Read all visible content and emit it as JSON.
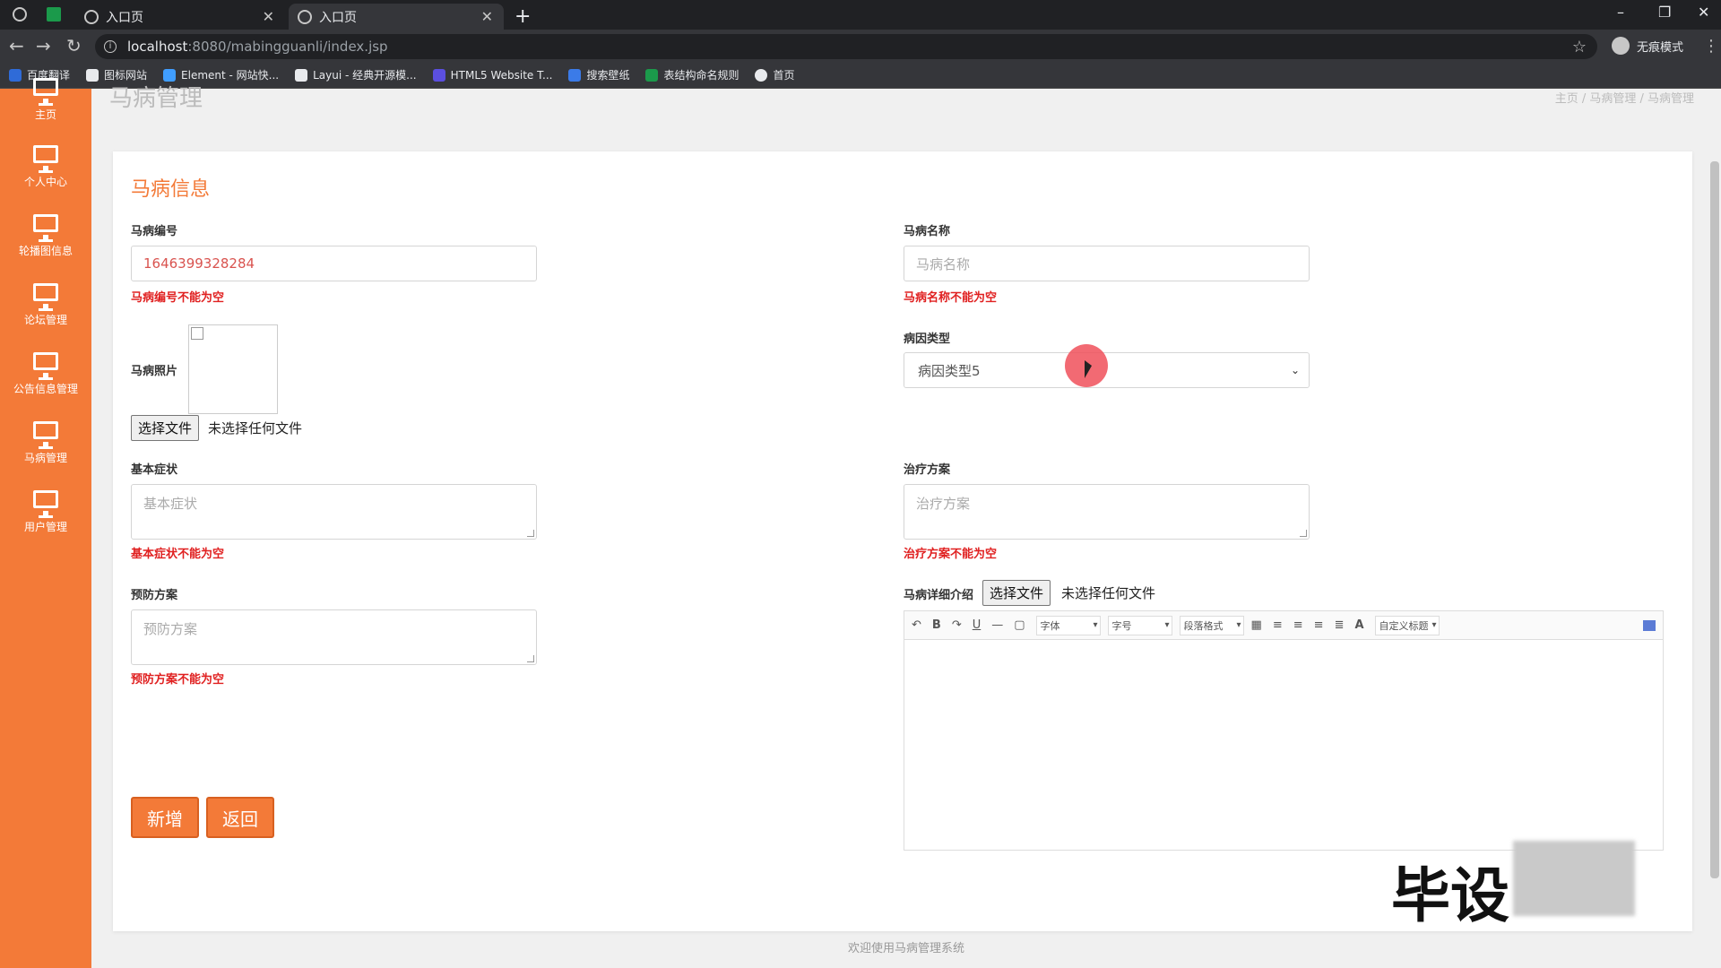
{
  "browser": {
    "tabs": [
      {
        "title": "入口页"
      },
      {
        "title": "入口页"
      }
    ],
    "url_host": "localhost",
    "url_path": ":8080/mabingguanli/index.jsp",
    "incognito_label": "无痕模式",
    "bookmarks": [
      {
        "label": "百度翻译",
        "color": "#2f6bd8"
      },
      {
        "label": "图标网站",
        "color": "#e8eaed"
      },
      {
        "label": "Element - 网站快...",
        "color": "#409eff"
      },
      {
        "label": "Layui - 经典开源模...",
        "color": "#e8eaed"
      },
      {
        "label": "HTML5 Website T...",
        "color": "#5b4fe0"
      },
      {
        "label": "搜索壁纸",
        "color": "#3b7be8"
      },
      {
        "label": "表结构命名规则",
        "color": "#1b9a4b"
      },
      {
        "label": "首页",
        "color": "#e8eaed"
      }
    ]
  },
  "sidebar": {
    "items": [
      {
        "label": "主页"
      },
      {
        "label": "个人中心"
      },
      {
        "label": "轮播图信息"
      },
      {
        "label": "论坛管理"
      },
      {
        "label": "公告信息管理"
      },
      {
        "label": "马病管理"
      },
      {
        "label": "用户管理"
      }
    ]
  },
  "page": {
    "title": "马病管理",
    "breadcrumb": "主页  /  马病管理  /  马病管理",
    "card_title": "马病信息"
  },
  "form": {
    "code_label": "马病编号",
    "code_value": "1646399328284",
    "code_error": "马病编号不能为空",
    "name_label": "马病名称",
    "name_placeholder": "马病名称",
    "name_error": "马病名称不能为空",
    "photo_label": "马病照片",
    "cause_label": "病因类型",
    "cause_value": "病因类型5",
    "file_button": "选择文件",
    "file_none": "未选择任何文件",
    "symptom_label": "基本症状",
    "symptom_placeholder": "基本症状",
    "symptom_error": "基本症状不能为空",
    "treatment_label": "治疗方案",
    "treatment_placeholder": "治疗方案",
    "treatment_error": "治疗方案不能为空",
    "prevention_label": "预防方案",
    "prevention_placeholder": "预防方案",
    "prevention_error": "预防方案不能为空",
    "detail_label": "马病详细介绍",
    "editor_font": "字体",
    "editor_size": "字号",
    "editor_paragraph": "段落格式",
    "editor_custom_title": "自定义标题",
    "submit_button": "新增",
    "back_button": "返回"
  },
  "footer": "欢迎使用马病管理系统",
  "watermark": "毕设",
  "colors": {
    "accent": "#f37a38",
    "error": "#e02020"
  }
}
